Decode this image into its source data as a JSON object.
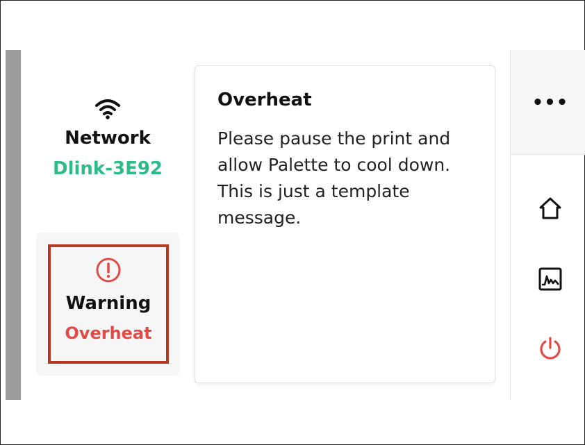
{
  "network": {
    "icon": "wifi-icon",
    "title": "Network",
    "name": "Dlink-3E92",
    "name_color": "#2dbb8a"
  },
  "warning": {
    "icon": "alert-circle-icon",
    "title": "Warning",
    "status": "Overheat",
    "status_color": "#e14b47",
    "highlight_color": "#b93a22"
  },
  "message": {
    "title": "Overheat",
    "body": "Please pause the print and allow Palette to cool down. This is just a template message."
  },
  "sidebar": {
    "more_label": "•••",
    "items": [
      {
        "icon": "home-icon"
      },
      {
        "icon": "chart-icon"
      },
      {
        "icon": "power-icon",
        "color": "#e14b47"
      }
    ]
  }
}
